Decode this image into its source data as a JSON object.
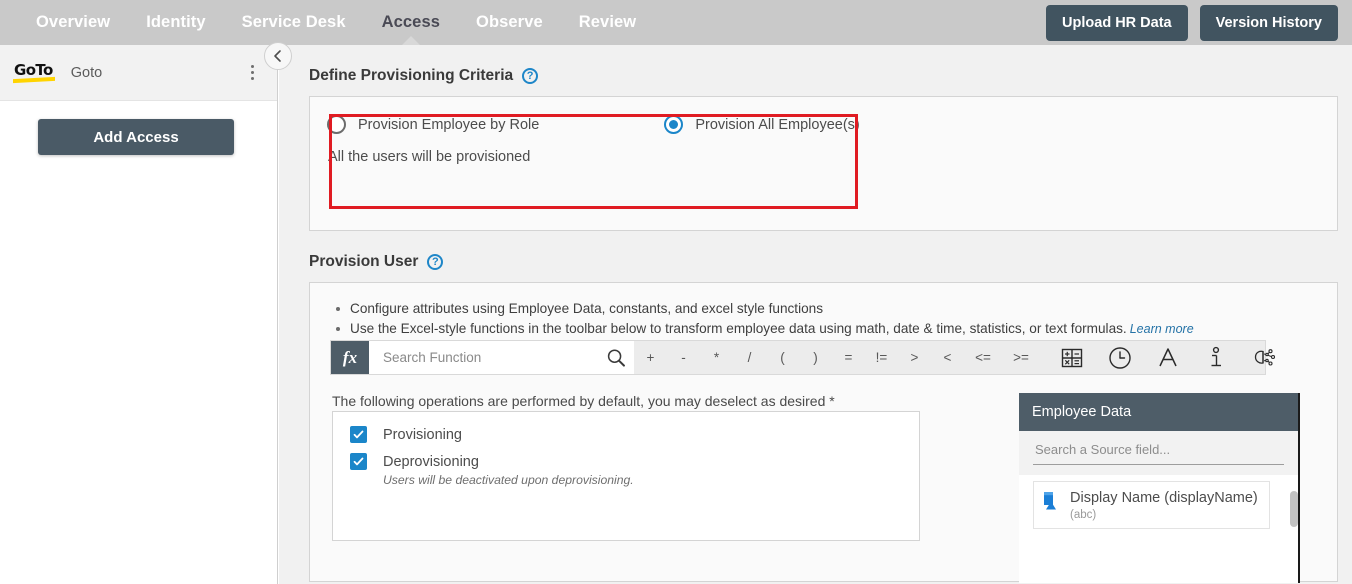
{
  "topnav": {
    "tabs": [
      {
        "label": "Overview",
        "active": false
      },
      {
        "label": "Identity",
        "active": false
      },
      {
        "label": "Service Desk",
        "active": false
      },
      {
        "label": "Access",
        "active": true
      },
      {
        "label": "Observe",
        "active": false
      },
      {
        "label": "Review",
        "active": false
      }
    ],
    "upload_button": "Upload HR Data",
    "version_button": "Version History",
    "background_color": "#c9c9c9",
    "button_color": "#415460"
  },
  "sidebar": {
    "logo_text": "GoTo",
    "logo_underline_color": "#ffd400",
    "app_name": "Goto",
    "kebab_menu": "more-options",
    "collapse_button": "collapse-sidebar",
    "add_access_button": "Add Access"
  },
  "criteria": {
    "section_title": "Define Provisioning Criteria",
    "help": "?",
    "highlight_color": "#e01b22",
    "options": [
      {
        "label": "Provision Employee by Role",
        "selected": false
      },
      {
        "label": "Provision All Employee(s)",
        "selected": true
      }
    ],
    "note": "All the users will be provisioned"
  },
  "provision": {
    "section_title": "Provision User",
    "help": "?",
    "bullets": [
      "Configure attributes using Employee Data, constants, and excel style functions",
      "Use the Excel-style functions in the toolbar below to transform employee data using math, date & time, statistics, or text formulas."
    ],
    "learn_more": "Learn more",
    "toolbar": {
      "fx_label": "fx",
      "search_placeholder": "Search Function",
      "search_value": "",
      "search_icon": "search-icon",
      "operators": [
        "+",
        "-",
        "*",
        "/",
        "(",
        ")",
        "=",
        "!=",
        ">",
        "<",
        "<=",
        ">="
      ],
      "icon_buttons": [
        {
          "name": "math-functions-icon",
          "title": "Math"
        },
        {
          "name": "datetime-functions-icon",
          "title": "Date & Time"
        },
        {
          "name": "text-functions-icon",
          "title": "Text"
        },
        {
          "name": "statistics-functions-icon",
          "title": "Statistics"
        },
        {
          "name": "ai-functions-icon",
          "title": "AI"
        }
      ]
    },
    "operations_note": "The following operations are performed by default, you may deselect as desired *",
    "operations": [
      {
        "label": "Provisioning",
        "checked": true,
        "sub": ""
      },
      {
        "label": "Deprovisioning",
        "checked": true,
        "sub": "Users will be deactivated upon deprovisioning."
      }
    ]
  },
  "employee_data": {
    "title": "Employee Data",
    "search_placeholder": "Search a Source field...",
    "search_value": "",
    "header_color": "#4e5d68",
    "fields": [
      {
        "name": "Display Name (displayName)",
        "type": "(abc)",
        "icon": "string-field-icon"
      }
    ]
  }
}
